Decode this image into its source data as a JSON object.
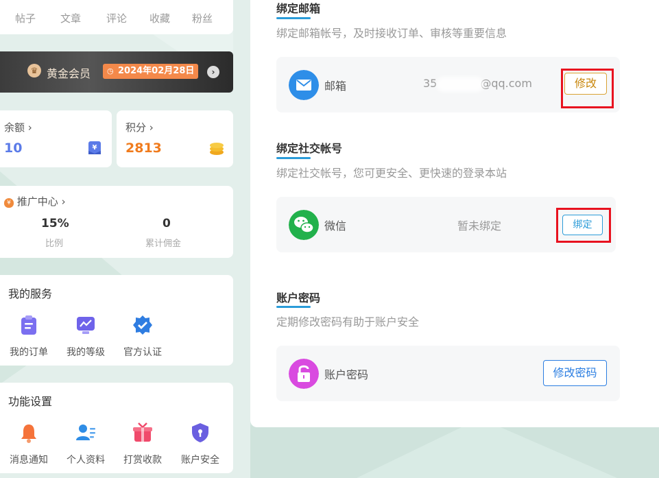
{
  "tabs": [
    "帖子",
    "文章",
    "评论",
    "收藏",
    "粉丝"
  ],
  "vip": {
    "label": "黄金会员",
    "date": "2024年02月28日",
    "icon": "crown-icon"
  },
  "balance": {
    "label": "余额",
    "value": "10",
    "icon": "yen-card-icon",
    "color": "#5b7be8"
  },
  "points": {
    "label": "积分",
    "value": "2813",
    "icon": "coins-icon",
    "color": "#f07b1d"
  },
  "promo": {
    "title": "推广中心",
    "ratio": {
      "value": "15%",
      "label": "比例"
    },
    "commission": {
      "value": "0",
      "label": "累计佣金"
    }
  },
  "services": {
    "title": "我的服务",
    "items": [
      {
        "label": "我的订单",
        "icon": "clipboard-icon"
      },
      {
        "label": "我的等级",
        "icon": "chart-icon"
      },
      {
        "label": "官方认证",
        "icon": "verified-icon"
      }
    ]
  },
  "settings": {
    "title": "功能设置",
    "items": [
      {
        "label": "消息通知",
        "icon": "bell-icon"
      },
      {
        "label": "个人资料",
        "icon": "user-card-icon"
      },
      {
        "label": "打赏收款",
        "icon": "gift-icon"
      },
      {
        "label": "账户安全",
        "icon": "shield-icon"
      }
    ]
  },
  "email_section": {
    "title": "绑定邮箱",
    "desc": "绑定邮箱帐号，及时接收订单、审核等重要信息",
    "label": "邮箱",
    "value": "35",
    "value_end": "@qq.com",
    "button": "修改"
  },
  "social_section": {
    "title": "绑定社交帐号",
    "desc": "绑定社交帐号，您可更安全、更快速的登录本站",
    "label": "微信",
    "value": "暂未绑定",
    "button": "绑定"
  },
  "password_section": {
    "title": "账户密码",
    "desc": "定期修改密码有助于账户安全",
    "label": "账户密码",
    "button": "修改密码"
  },
  "colors": {
    "accent": "#2a9bd8",
    "highlight": "#e8121f",
    "email_btn": "#c8860a",
    "bind_btn": "#2a9bd8"
  }
}
